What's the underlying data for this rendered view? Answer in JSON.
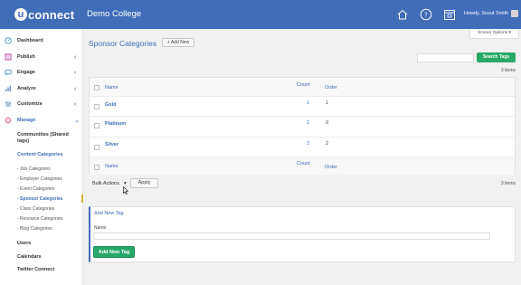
{
  "topbar": {
    "logo_text": "connect",
    "logo_letter": "u",
    "site_name": "Demo College",
    "howdy": "Howdy, Scout Smith",
    "icons": [
      "home-icon",
      "help-icon",
      "calendar-icon"
    ]
  },
  "sidebar": {
    "items": [
      {
        "label": "Dashboard",
        "icon": "dashboard-icon"
      },
      {
        "label": "Publish",
        "icon": "publish-icon"
      },
      {
        "label": "Engage",
        "icon": "engage-icon"
      },
      {
        "label": "Analyze",
        "icon": "analyze-icon"
      },
      {
        "label": "Customize",
        "icon": "customize-icon"
      },
      {
        "label": "Manage",
        "icon": "manage-icon"
      }
    ],
    "manage_sub": [
      "Communities (Shared",
      "tags)",
      "Content Categories"
    ],
    "categories": [
      "- Job Categories",
      "- Employer Categories",
      "- Event Categories",
      "- Sponsor Categories",
      "- Class Categories",
      "- Resource Categories",
      "- Blog Categories"
    ],
    "bottom": [
      "Users",
      "Calendars",
      "Twitter Connect"
    ]
  },
  "main": {
    "title": "Sponsor Categories",
    "add_new": "+ Add New",
    "screen_options": "Screen Options ▾",
    "search_button": "Search Tags",
    "items_count": "3 items",
    "table": {
      "headers": {
        "name": "Name",
        "count": "Count",
        "order": "Order"
      },
      "rows": [
        {
          "name": "Gold",
          "count": "1",
          "order": "1"
        },
        {
          "name": "Platinum",
          "count": "2",
          "order": "0"
        },
        {
          "name": "Silver",
          "count": "2",
          "order": "2"
        }
      ]
    },
    "bulk_actions": "Bulk Actions",
    "bulk_caret": "▾",
    "apply": "Apply",
    "add_panel": {
      "title": "Add New Tag",
      "name_label": "Name",
      "button": "Add New Tag"
    }
  },
  "colors": {
    "accent": "#3f6db8",
    "green": "#27a869",
    "topbar": "#3f6db8"
  }
}
